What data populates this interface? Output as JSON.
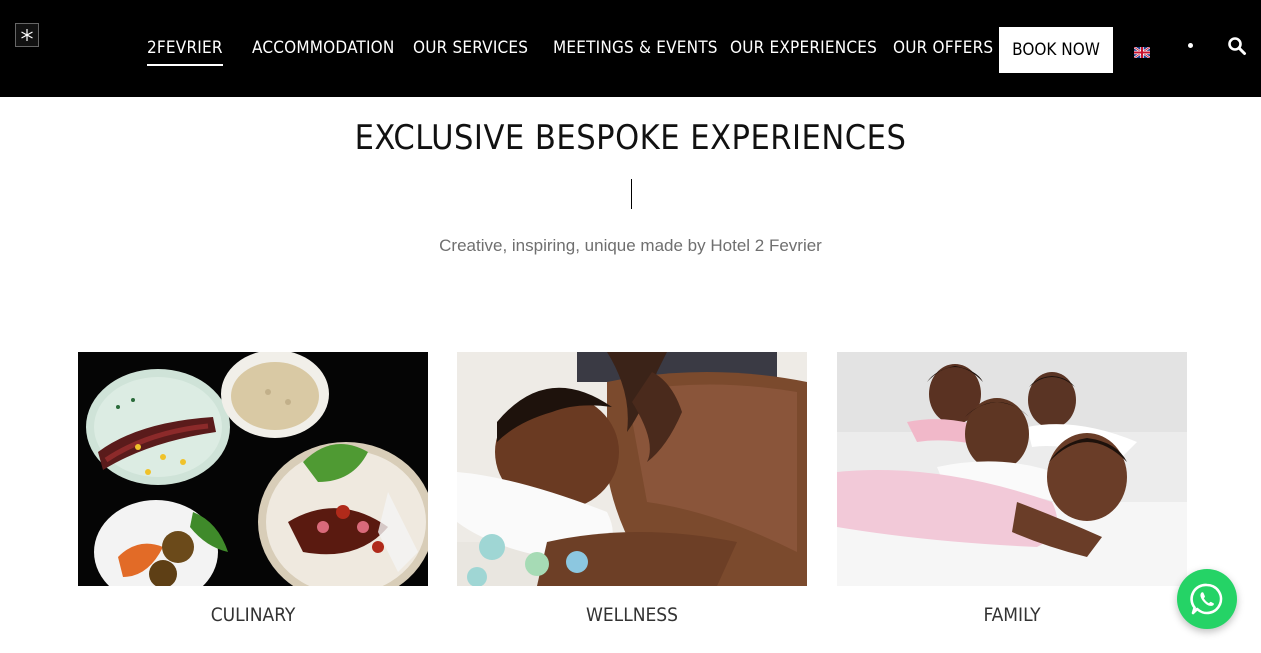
{
  "nav": {
    "items": [
      {
        "label": "2FEVRIER",
        "active": true
      },
      {
        "label": "ACCOMMODATION"
      },
      {
        "label": "OUR SERVICES"
      },
      {
        "label": "MEETINGS & EVENTS"
      },
      {
        "label": "OUR EXPERIENCES"
      },
      {
        "label": "OUR OFFERS"
      }
    ],
    "book_label": "BOOK NOW",
    "language_icon": "uk-flag-icon",
    "search_icon": "search-icon"
  },
  "hero": {
    "title": "EXCLUSIVE BESPOKE EXPERIENCES",
    "subtitle": "Creative, inspiring, unique made by Hotel 2 Fevrier"
  },
  "cards": [
    {
      "label": "CULINARY"
    },
    {
      "label": "WELLNESS"
    },
    {
      "label": "FAMILY"
    }
  ],
  "colors": {
    "nav_bg": "#000000",
    "nav_text": "#ffffff",
    "whatsapp": "#25d366",
    "subtitle": "#6f6f6f"
  }
}
